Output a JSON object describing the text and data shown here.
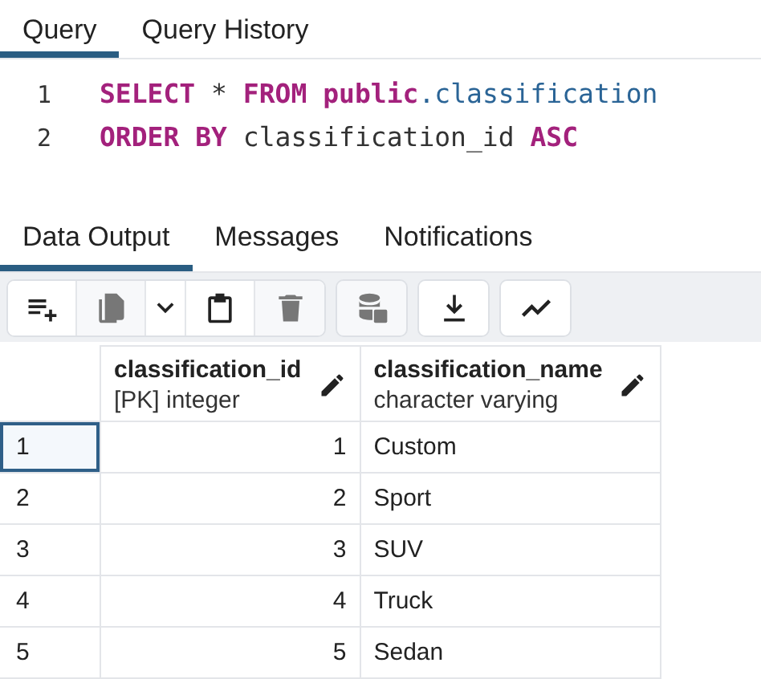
{
  "query_tabs": [
    {
      "label": "Query",
      "selected": true
    },
    {
      "label": "Query History",
      "selected": false
    }
  ],
  "editor": {
    "lines": [
      {
        "number": "1",
        "tokens": [
          {
            "kind": "keyword",
            "text": "SELECT"
          },
          {
            "kind": "plain",
            "text": " * "
          },
          {
            "kind": "keyword",
            "text": "FROM public"
          },
          {
            "kind": "ident",
            "text": ".classification"
          }
        ]
      },
      {
        "number": "2",
        "tokens": [
          {
            "kind": "keyword",
            "text": "ORDER BY"
          },
          {
            "kind": "plain",
            "text": " classification_id "
          },
          {
            "kind": "keyword",
            "text": "ASC"
          }
        ]
      }
    ]
  },
  "result_tabs": [
    {
      "label": "Data Output",
      "selected": true
    },
    {
      "label": "Messages",
      "selected": false
    },
    {
      "label": "Notifications",
      "selected": false
    }
  ],
  "toolbar": [
    [
      {
        "kind": "add-row",
        "disabled": false
      },
      {
        "kind": "copy",
        "disabled": true
      },
      {
        "kind": "dropdown",
        "disabled": false
      },
      {
        "kind": "paste",
        "disabled": false
      },
      {
        "kind": "delete",
        "disabled": true
      }
    ],
    [
      {
        "kind": "save",
        "disabled": true
      }
    ],
    [
      {
        "kind": "download",
        "disabled": false
      }
    ],
    [
      {
        "kind": "graph",
        "disabled": false
      }
    ]
  ],
  "table": {
    "columns": [
      {
        "name": "classification_id",
        "type": "[PK] integer"
      },
      {
        "name": "classification_name",
        "type": "character varying"
      }
    ],
    "rows": [
      {
        "number": "1",
        "selected": true,
        "cells": [
          "1",
          "Custom"
        ]
      },
      {
        "number": "2",
        "selected": false,
        "cells": [
          "2",
          "Sport"
        ]
      },
      {
        "number": "3",
        "selected": false,
        "cells": [
          "3",
          "SUV"
        ]
      },
      {
        "number": "4",
        "selected": false,
        "cells": [
          "4",
          "Truck"
        ]
      },
      {
        "number": "5",
        "selected": false,
        "cells": [
          "5",
          "Sedan"
        ]
      }
    ]
  }
}
